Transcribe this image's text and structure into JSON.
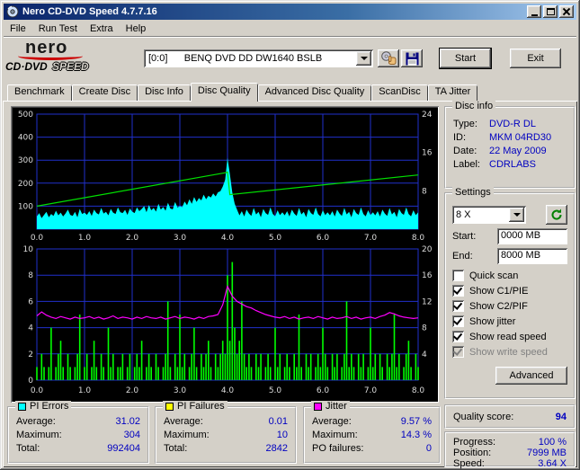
{
  "window": {
    "title": "Nero CD-DVD Speed 4.7.7.16"
  },
  "menu": {
    "items": [
      "File",
      "Run Test",
      "Extra",
      "Help"
    ]
  },
  "toolbar": {
    "logo": {
      "brand": "nero",
      "line2a": "CD·DVD",
      "line2b": "SPEED"
    },
    "drive_select": "[0:0]      BENQ DVD DD DW1640 BSLB",
    "start_label": "Start",
    "exit_label": "Exit"
  },
  "tabs": {
    "items": [
      "Benchmark",
      "Create Disc",
      "Disc Info",
      "Disc Quality",
      "Advanced Disc Quality",
      "ScanDisc",
      "TA Jitter"
    ],
    "active": "Disc Quality"
  },
  "disc_info": {
    "legend": "Disc info",
    "rows": [
      {
        "label": "Type:",
        "value": "DVD-R DL"
      },
      {
        "label": "ID:",
        "value": "MKM 04RD30"
      },
      {
        "label": "Date:",
        "value": "22 May 2009"
      },
      {
        "label": "Label:",
        "value": "CDRLABS"
      }
    ]
  },
  "settings": {
    "legend": "Settings",
    "speed_value": "8 X",
    "start_label": "Start:",
    "start_value": "0000 MB",
    "end_label": "End:",
    "end_value": "8000 MB",
    "checkboxes": [
      {
        "label": "Quick scan",
        "checked": false,
        "disabled": false
      },
      {
        "label": "Show C1/PIE",
        "checked": true,
        "disabled": false
      },
      {
        "label": "Show C2/PIF",
        "checked": true,
        "disabled": false
      },
      {
        "label": "Show jitter",
        "checked": true,
        "disabled": false
      },
      {
        "label": "Show read speed",
        "checked": true,
        "disabled": false
      },
      {
        "label": "Show write speed",
        "checked": true,
        "disabled": true
      }
    ],
    "advanced_label": "Advanced"
  },
  "quality": {
    "label": "Quality score:",
    "value": "94"
  },
  "progress": {
    "rows": [
      {
        "label": "Progress:",
        "value": "100 %"
      },
      {
        "label": "Position:",
        "value": "7999 MB"
      },
      {
        "label": "Speed:",
        "value": "3.64 X"
      }
    ]
  },
  "stats": {
    "pi_errors": {
      "legend": "PI Errors",
      "color": "#00ffff",
      "rows": [
        [
          "Average:",
          "31.02"
        ],
        [
          "Maximum:",
          "304"
        ],
        [
          "Total:",
          "992404"
        ]
      ]
    },
    "pi_failures": {
      "legend": "PI Failures",
      "color": "#ffff00",
      "rows": [
        [
          "Average:",
          "0.01"
        ],
        [
          "Maximum:",
          "10"
        ],
        [
          "Total:",
          "2842"
        ]
      ]
    },
    "jitter": {
      "legend": "Jitter",
      "color": "#ff00ff",
      "rows": [
        [
          "Average:",
          "9.57 %"
        ],
        [
          "Maximum:",
          "14.3 %"
        ],
        [
          "PO failures:",
          "0"
        ]
      ]
    }
  },
  "chart_data": [
    {
      "type": "area",
      "name": "pi-errors-and-read-speed",
      "x_range": [
        0,
        8
      ],
      "x_tick_step": 1,
      "x_ticks": [
        "0.0",
        "1.0",
        "2.0",
        "3.0",
        "4.0",
        "5.0",
        "6.0",
        "7.0",
        "8.0"
      ],
      "grid_color": "#2030cc",
      "axis_color": "#dcdcdc",
      "left_axis": {
        "range": [
          0,
          500
        ],
        "ticks": [
          500,
          400,
          300,
          200,
          100
        ]
      },
      "right_axis": {
        "range": [
          0,
          24
        ],
        "ticks": [
          24,
          16,
          8
        ]
      },
      "series": [
        {
          "name": "PI Errors (C1/PIE)",
          "type": "area",
          "axis": "left",
          "color": "#00ffff",
          "x_step": 0.05,
          "values": [
            55,
            70,
            48,
            62,
            75,
            52,
            66,
            58,
            80,
            60,
            72,
            55,
            68,
            85,
            62,
            58,
            75,
            52,
            88,
            66,
            72,
            62,
            78,
            58,
            85,
            70,
            64,
            92,
            68,
            75,
            60,
            88,
            72,
            66,
            95,
            74,
            70,
            84,
            62,
            90,
            76,
            70,
            95,
            78,
            88,
            100,
            74,
            105,
            82,
            92,
            76,
            110,
            85,
            96,
            80,
            115,
            90,
            86,
            118,
            94,
            100,
            96,
            120,
            104,
            130,
            110,
            140,
            118,
            135,
            125,
            150,
            130,
            145,
            138,
            155,
            142,
            160,
            165,
            185,
            215,
            310,
            240,
            160,
            110,
            85,
            60,
            78,
            55,
            85,
            68,
            58,
            92,
            64,
            75,
            52,
            88,
            70,
            62,
            95,
            66,
            56,
            82,
            61,
            73,
            60,
            78,
            55,
            85,
            68,
            58,
            92,
            64,
            75,
            52,
            88,
            70,
            62,
            95,
            66,
            56,
            82,
            61,
            73,
            60,
            78,
            55,
            85,
            68,
            58,
            92,
            64,
            75,
            52,
            88,
            70,
            62,
            95,
            66,
            56,
            82,
            61,
            73,
            60,
            78,
            55,
            85,
            68,
            58,
            92,
            64,
            75,
            52,
            88,
            70,
            62,
            95,
            66,
            56,
            82,
            61,
            73
          ]
        },
        {
          "name": "Read speed (X)",
          "type": "line",
          "axis": "right",
          "color": "#00e000",
          "points": [
            [
              0,
              4.8
            ],
            [
              3.97,
              11.8
            ],
            [
              4.0,
              11.9
            ],
            [
              4.05,
              7.2
            ],
            [
              8,
              11.3
            ]
          ]
        }
      ]
    },
    {
      "type": "bar",
      "name": "pi-failures-and-jitter",
      "x_range": [
        0,
        8
      ],
      "x_tick_step": 1,
      "x_ticks": [
        "0.0",
        "1.0",
        "2.0",
        "3.0",
        "4.0",
        "5.0",
        "6.0",
        "7.0",
        "8.0"
      ],
      "grid_color": "#2030cc",
      "axis_color": "#dcdcdc",
      "left_axis": {
        "range": [
          0,
          10
        ],
        "ticks": [
          10,
          8,
          6,
          4,
          2,
          0
        ]
      },
      "right_axis": {
        "range": [
          0,
          20
        ],
        "ticks": [
          20,
          16,
          12,
          8,
          4
        ]
      },
      "series": [
        {
          "name": "PI Failures (C2/PIF)",
          "type": "bars",
          "axis": "left",
          "color": "#00ff00",
          "x_step": 0.05,
          "values": [
            1,
            0,
            2,
            1,
            0,
            1,
            4,
            0,
            1,
            2,
            3,
            1,
            0,
            2,
            1,
            0,
            1,
            2,
            5,
            0,
            1,
            2,
            0,
            1,
            3,
            1,
            0,
            2,
            1,
            0,
            4,
            1,
            2,
            0,
            1,
            1,
            2,
            0,
            1,
            2,
            0,
            1,
            2,
            1,
            3,
            0,
            1,
            2,
            1,
            0,
            2,
            1,
            0,
            1,
            2,
            6,
            1,
            0,
            2,
            1,
            5,
            1,
            2,
            0,
            1,
            2,
            4,
            1,
            0,
            2,
            1,
            2,
            3,
            1,
            0,
            2,
            1,
            2,
            3,
            2,
            8,
            3,
            9,
            4,
            2,
            3,
            6,
            2,
            1,
            2,
            1,
            0,
            2,
            1,
            2,
            0,
            1,
            2,
            1,
            0,
            4,
            1,
            2,
            0,
            1,
            2,
            1,
            0,
            2,
            1,
            5,
            1,
            0,
            2,
            1,
            2,
            0,
            1,
            2,
            1,
            4,
            2,
            1,
            0,
            2,
            1,
            2,
            0,
            1,
            2,
            6,
            1,
            2,
            1,
            0,
            2,
            1,
            2,
            0,
            1,
            4,
            1,
            2,
            0,
            2,
            1,
            0,
            2,
            1,
            2,
            5,
            1,
            2,
            0,
            1,
            2,
            3,
            1,
            0,
            2,
            1
          ]
        },
        {
          "name": "Jitter (%)",
          "type": "line",
          "axis": "right",
          "color": "#ff00ff",
          "x_step": 0.1,
          "values": [
            9.8,
            10.4,
            9.9,
            9.6,
            9.4,
            9.7,
            9.5,
            9.3,
            9.6,
            9.4,
            9.5,
            9.7,
            9.4,
            9.6,
            9.3,
            9.5,
            9.8,
            9.4,
            9.6,
            9.5,
            9.3,
            9.6,
            9.4,
            9.7,
            9.5,
            9.4,
            9.6,
            9.3,
            9.5,
            9.7,
            9.4,
            9.6,
            9.5,
            9.3,
            9.6,
            9.4,
            9.7,
            9.8,
            10.0,
            11.5,
            14.3,
            12.8,
            12.0,
            11.6,
            11.2,
            11.0,
            10.6,
            10.3,
            10.0,
            9.8,
            9.6,
            9.5,
            9.7,
            9.4,
            9.6,
            9.3,
            9.5,
            9.6,
            9.4,
            9.7,
            9.5,
            9.3,
            9.6,
            9.4,
            9.5,
            9.7,
            9.4,
            9.6,
            9.3,
            9.5,
            9.6,
            9.4,
            9.7,
            9.9,
            10.3,
            10.1,
            9.8,
            9.6,
            9.5,
            9.4,
            9.5
          ]
        }
      ]
    }
  ]
}
